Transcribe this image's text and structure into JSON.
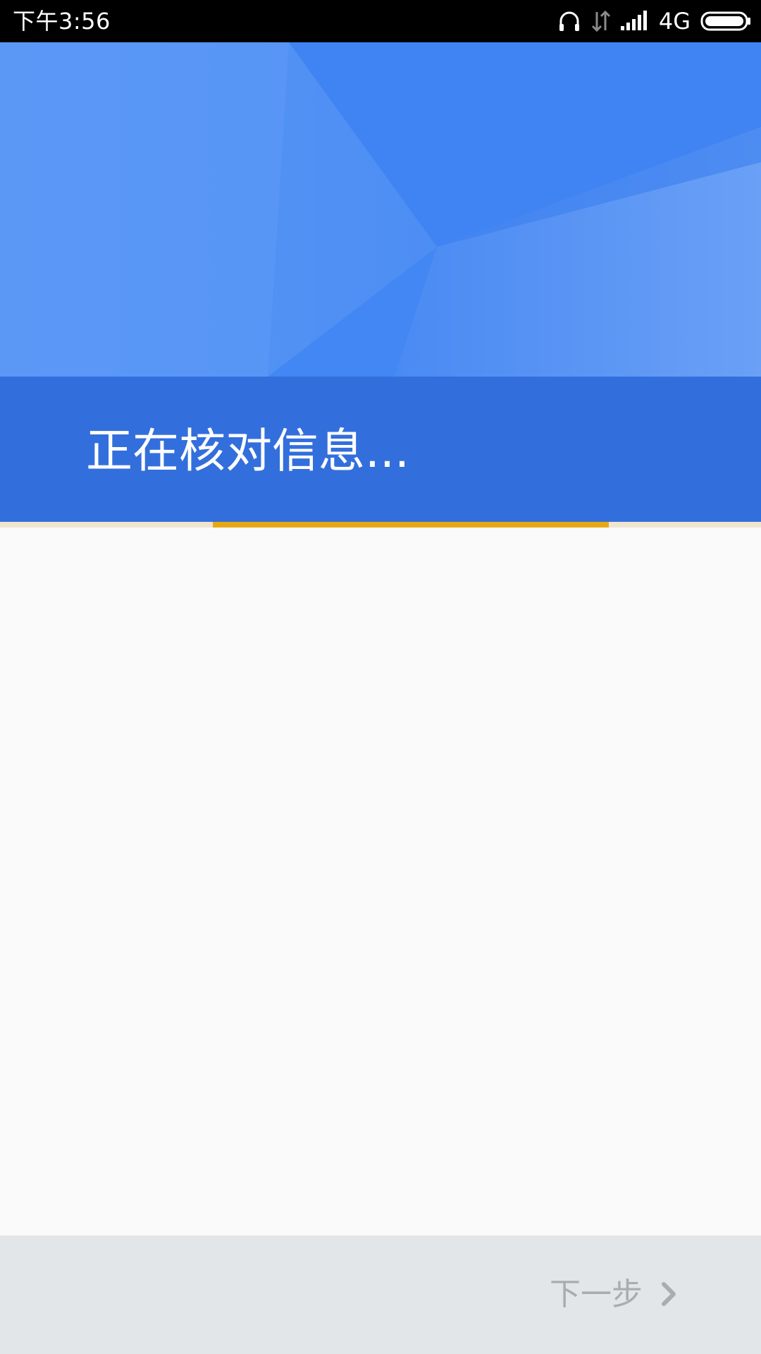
{
  "status_bar": {
    "time": "下午3:56",
    "network": "4G",
    "icons": [
      "headphones-icon",
      "data-arrows-icon",
      "signal-icon",
      "battery-icon"
    ]
  },
  "header": {
    "title": "正在核对信息..."
  },
  "progress": {
    "indeterminate": true,
    "visible_start": 0.28,
    "visible_end": 0.8
  },
  "footer": {
    "next_label": "下一步",
    "next_icon": "chevron-right-icon"
  },
  "colors": {
    "header_blue": "#4286f3",
    "title_band": "#336fdc",
    "progress": "#e8a814",
    "footer_bg": "#e3e6e9",
    "disabled_text": "#a9acb0"
  }
}
